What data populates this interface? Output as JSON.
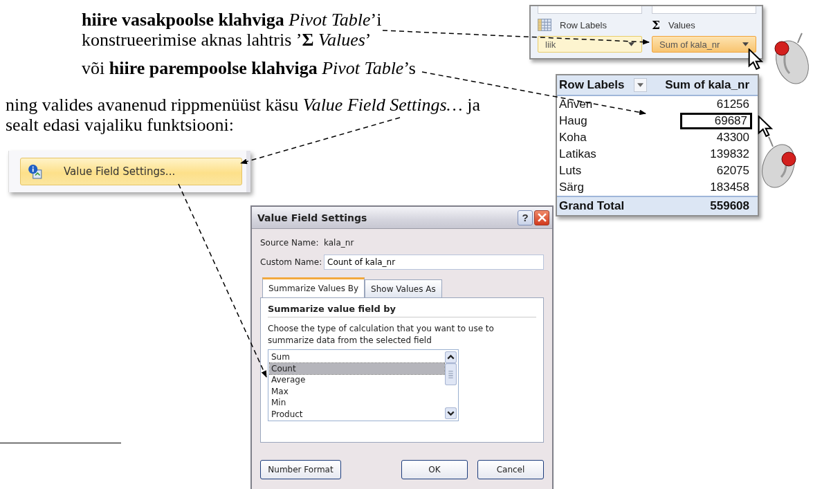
{
  "paragraphs": [
    {
      "lines": [
        "**hiire vasakpoolse klahviga** *Pivot Table*’i",
        "konstrueerimise aknas lahtris ’**Σ** *Values*’"
      ]
    },
    {
      "lines": [
        "või **hiire parempoolse klahviga** *Pivot Table*’s"
      ]
    },
    {
      "lines": [
        "ning valides avanenud rippmenüüst käsu *Value Field Settings…* ja",
        "sealt edasi vajaliku funktsiooni:"
      ]
    }
  ],
  "context_menu": {
    "item": {
      "label": "Value Field Settings...",
      "highlighted": true
    }
  },
  "field_list": {
    "areas": [
      {
        "label": "Row Labels",
        "kind": "rows",
        "field": "liik",
        "selected": false
      },
      {
        "label": "Values",
        "kind": "values",
        "symbol": "Σ",
        "field": "Sum of kala_nr",
        "selected": true
      }
    ]
  },
  "pivot_table": {
    "columns": [
      "Row Labels",
      "Sum of kala_nr"
    ],
    "rows": [
      {
        "label": "Ahven",
        "value": "61256",
        "selected": false
      },
      {
        "label": "Haug",
        "value": "69687",
        "selected": true
      },
      {
        "label": "Koha",
        "value": "43300",
        "selected": false
      },
      {
        "label": "Latikas",
        "value": "139832",
        "selected": false
      },
      {
        "label": "Luts",
        "value": "62075",
        "selected": false
      },
      {
        "label": "Särg",
        "value": "183458",
        "selected": false
      }
    ],
    "total": {
      "label": "Grand Total",
      "value": "559608"
    }
  },
  "dialog": {
    "title": "Value Field Settings",
    "help_label": "?",
    "source_name_label": "Source Name:",
    "source_name": "kala_nr",
    "custom_name_label": "Custom Name:",
    "custom_name": "Count of kala_nr",
    "tabs": [
      {
        "label": "Summarize Values By",
        "selected": true
      },
      {
        "label": "Show Values As",
        "selected": false
      }
    ],
    "section_title": "Summarize value field by",
    "description": "Choose the type of calculation that you want to use to summarize data from the selected field",
    "functions": [
      {
        "label": "Sum",
        "selected": false
      },
      {
        "label": "Count",
        "selected": true
      },
      {
        "label": "Average",
        "selected": false
      },
      {
        "label": "Max",
        "selected": false
      },
      {
        "label": "Min",
        "selected": false
      },
      {
        "label": "Product",
        "selected": false
      }
    ],
    "buttons": [
      "Number Format",
      "OK",
      "Cancel"
    ]
  }
}
